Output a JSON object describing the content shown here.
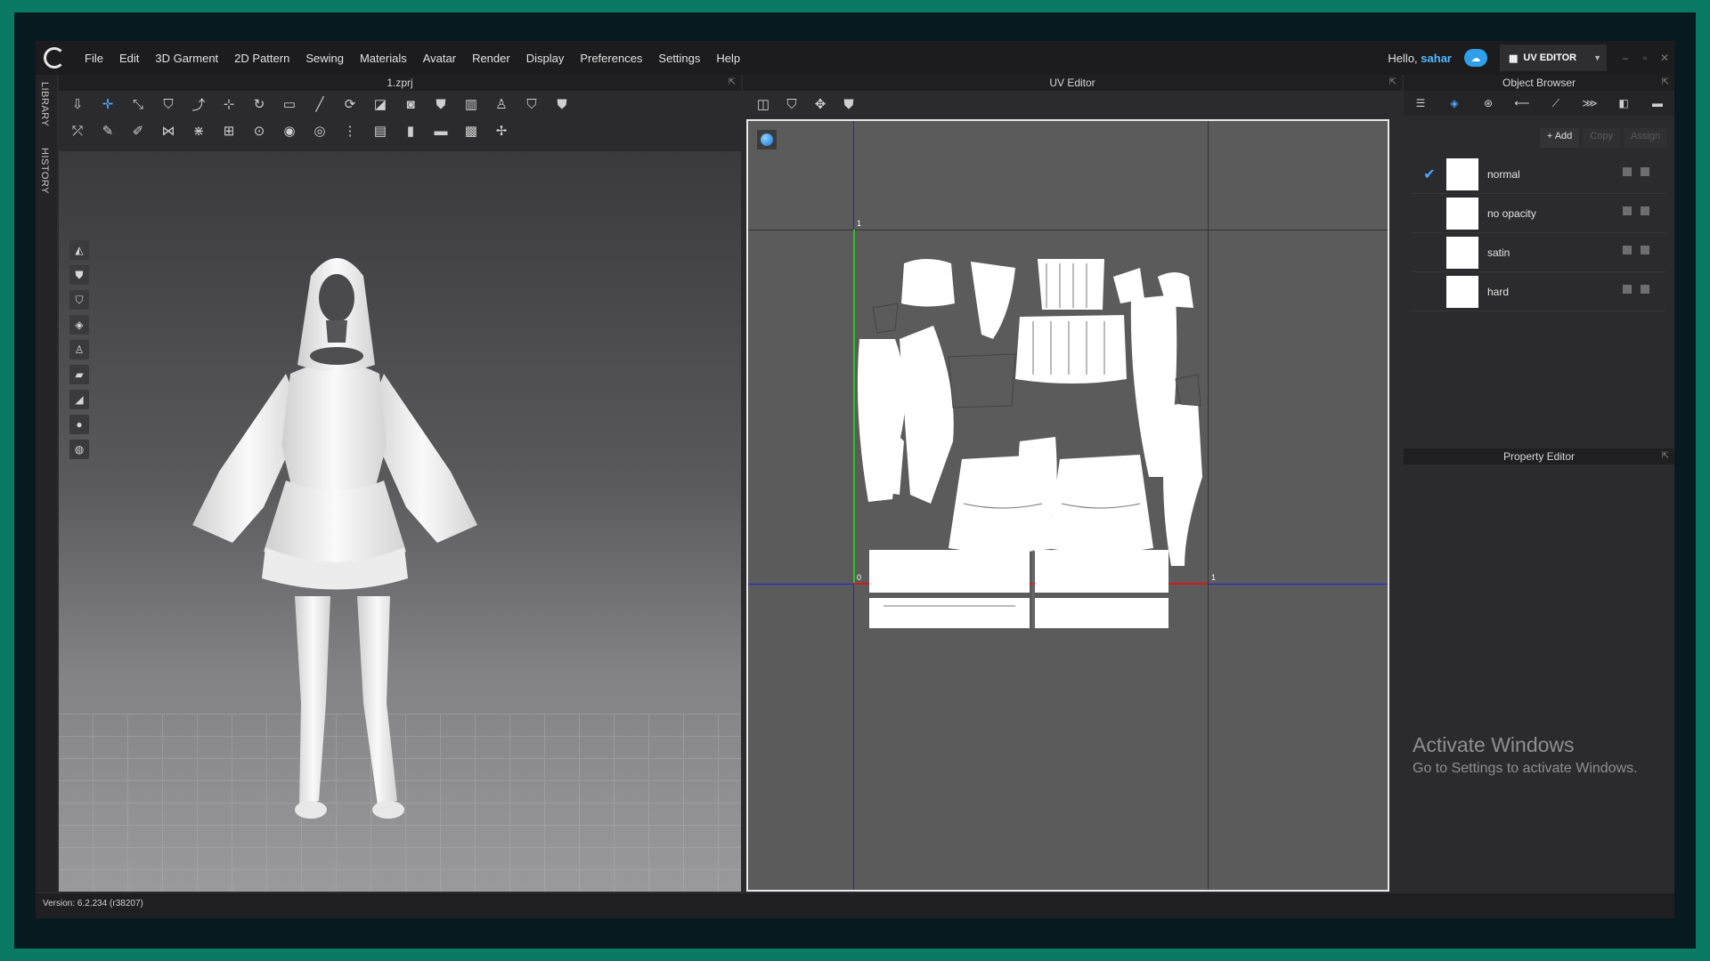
{
  "menubar": {
    "items": [
      "File",
      "Edit",
      "3D Garment",
      "2D Pattern",
      "Sewing",
      "Materials",
      "Avatar",
      "Render",
      "Display",
      "Preferences",
      "Settings",
      "Help"
    ],
    "hello_prefix": "Hello,",
    "user": "sahar",
    "mode_label": "UV EDITOR"
  },
  "sidetabs": {
    "library": "LIBRARY",
    "history": "HISTORY"
  },
  "view3d": {
    "file_title": "1.zprj"
  },
  "uv_editor": {
    "title": "UV Editor",
    "axis_labels": {
      "top": "1",
      "origin": "0",
      "right": "1"
    }
  },
  "object_browser": {
    "title": "Object Browser",
    "add_label": "+ Add",
    "copy_label": "Copy",
    "assign_label": "Assign",
    "materials": [
      {
        "name": "normal",
        "checked": true
      },
      {
        "name": "no opacity",
        "checked": false
      },
      {
        "name": "satin",
        "checked": false
      },
      {
        "name": "hard",
        "checked": false
      }
    ]
  },
  "property_editor": {
    "title": "Property Editor"
  },
  "watermark": {
    "line1": "Activate Windows",
    "line2": "Go to Settings to activate Windows."
  },
  "statusbar": {
    "version": "Version: 6.2.234 (r38207)"
  },
  "colors": {
    "accent": "#4aa8ff",
    "uv_x_axis": "#d11a1a",
    "uv_y_axis": "#2bbf2b",
    "uv_guides": "#2222dd"
  }
}
